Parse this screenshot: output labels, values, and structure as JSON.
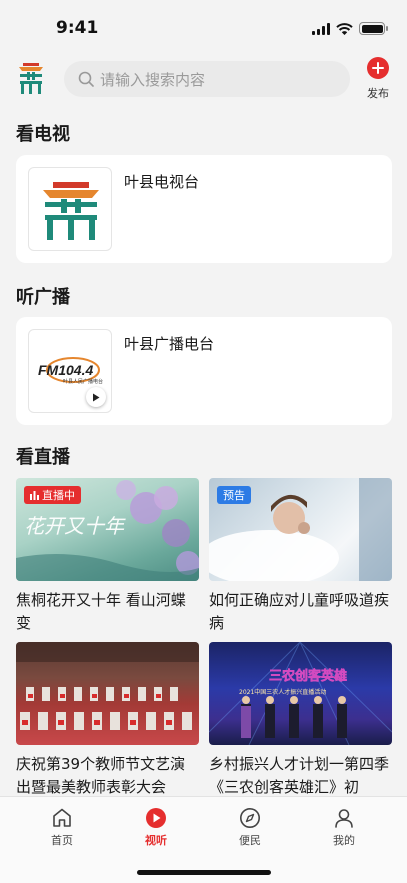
{
  "status_bar": {
    "time": "9:41"
  },
  "header": {
    "search_placeholder": "请输入搜索内容",
    "publish_label": "发布"
  },
  "sections": {
    "tv_title": "看电视",
    "radio_title": "听广播",
    "live_title": "看直播"
  },
  "tv": {
    "name": "叶县电视台"
  },
  "radio": {
    "name": "叶县广播电台",
    "logo_text": "FM104.4",
    "logo_sub": "叶县人民广播电台"
  },
  "live": [
    {
      "title": "焦桐花开又十年 看山河蝶变",
      "badge": "直播中",
      "badge_type": "live",
      "overlay_text": "花开又十年"
    },
    {
      "title": "如何正确应对儿童呼吸道疾病",
      "badge": "预告",
      "badge_type": "preview"
    },
    {
      "title": "庆祝第39个教师节文艺演出暨最美教师表彰大会",
      "badge": "",
      "badge_type": "none"
    },
    {
      "title": "乡村振兴人才计划一第四季《三农创客英雄汇》初",
      "badge": "",
      "badge_type": "none",
      "overlay_text": "三农创客英雄",
      "overlay_sub": "2021中国三农人才振兴直播活动"
    }
  ],
  "tabbar": {
    "items": [
      {
        "label": "首页",
        "icon": "home-icon",
        "active": false
      },
      {
        "label": "视听",
        "icon": "play-icon",
        "active": true
      },
      {
        "label": "便民",
        "icon": "compass-icon",
        "active": false
      },
      {
        "label": "我的",
        "icon": "user-icon",
        "active": false
      }
    ]
  },
  "colors": {
    "accent": "#e52e2e",
    "preview_badge": "#2c7be5",
    "logo_green": "#1f8a7a",
    "logo_orange": "#e5862e",
    "logo_red": "#d23a2a"
  }
}
